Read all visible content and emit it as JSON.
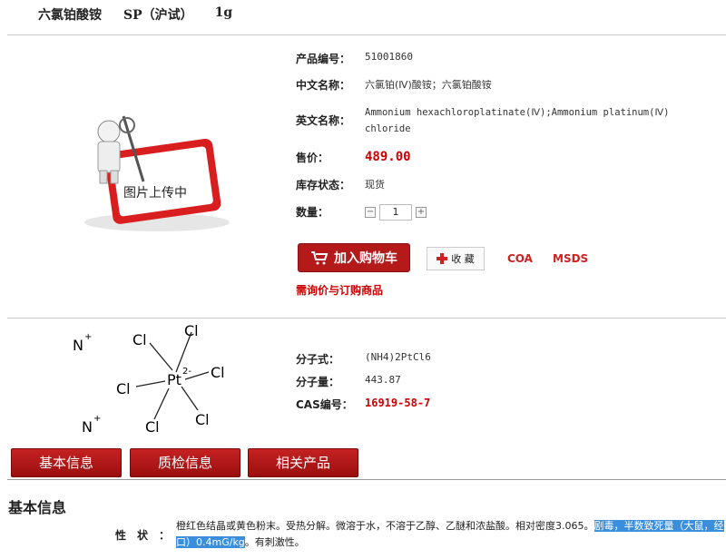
{
  "header": {
    "name": "六氯铂酸铵",
    "grade": "SP（沪试）",
    "size": "1g"
  },
  "image": {
    "placeholder_text": "图片上传中"
  },
  "product": {
    "code_label": "产品编号：",
    "code": "51001860",
    "cn_name_label": "中文名称：",
    "cn_name": "六氯铂(Ⅳ)酸铵；六氯铂酸铵",
    "en_name_label": "英文名称：",
    "en_name_line1": "Ammonium hexachloroplatinate(Ⅳ);Ammonium platinum(Ⅳ)",
    "en_name_line2": "chloride",
    "price_label": "售价：",
    "price": "489.00",
    "stock_label": "库存状态：",
    "stock": "现货",
    "qty_label": "数量：",
    "qty": "1",
    "qty_minus": "−",
    "qty_plus": "+"
  },
  "actions": {
    "add_to_cart": "加入购物车",
    "favorite": "收 藏",
    "coa": "COA",
    "msds": "MSDS",
    "inquire": "需询价与订购商品"
  },
  "molecule": {
    "formula_label": "分子式：",
    "formula": "(NH4)2PtCl6",
    "weight_label": "分子量：",
    "weight": "443.87",
    "cas_label": "CAS编号：",
    "cas": "16919-58-7",
    "atoms": {
      "n": "N",
      "plus": "+",
      "cl": "Cl",
      "pt": "Pt",
      "charge": "2-"
    }
  },
  "tabs": [
    "基本信息",
    "质检信息",
    "相关产品"
  ],
  "basic": {
    "section_title": "基本信息",
    "property_label": "性状：",
    "property_text": "橙红色结晶或黄色粉末。受热分解。微溶于水，不溶于乙醇、乙醚和浓盐酸。相对密度3.065。",
    "property_highlight": "剧毒，半数致死量（大鼠，经口）0.4mG/kg",
    "property_tail": "。有刺激性。"
  },
  "colors": {
    "accent_red": "#b51a1a",
    "price_red": "#cc0000",
    "highlight_blue": "#3b8edc"
  }
}
